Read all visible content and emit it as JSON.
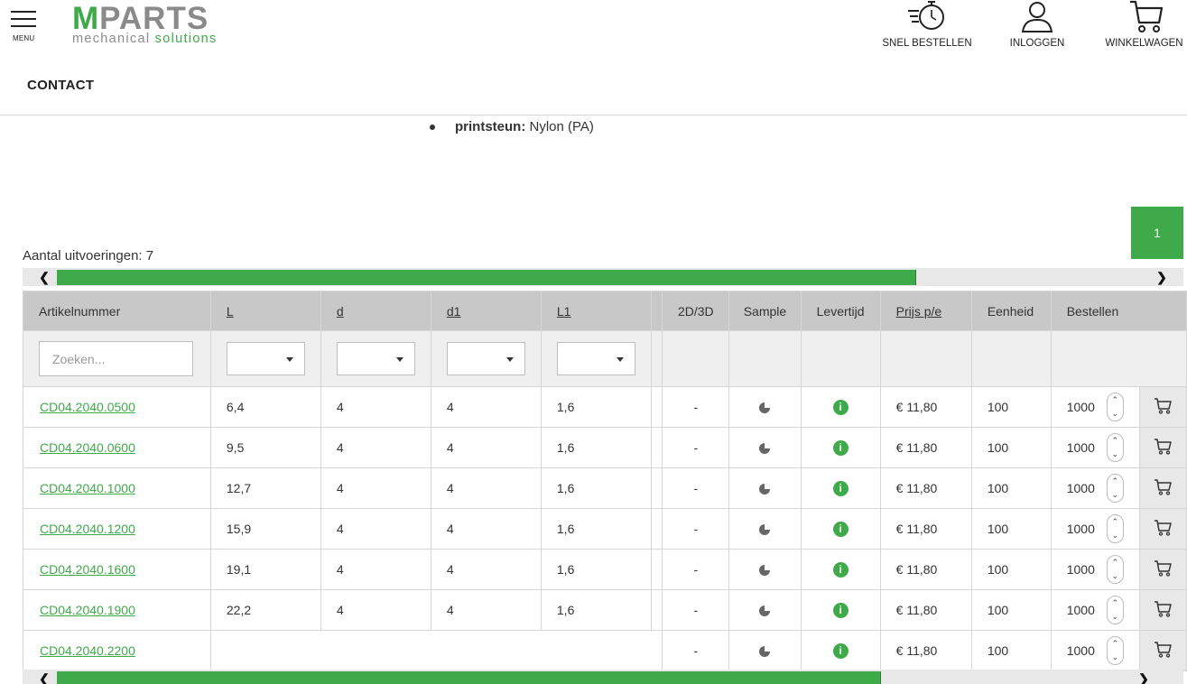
{
  "header": {
    "menu_label": "MENU",
    "logo": {
      "main_m": "M",
      "main_rest": "PARTS",
      "sub_grey": "mechanical ",
      "sub_green": "solutions"
    },
    "actions": [
      {
        "label": "SNEL BESTELLEN",
        "icon": "stopwatch-icon"
      },
      {
        "label": "INLOGGEN",
        "icon": "user-icon"
      },
      {
        "label": "WINKELWAGEN",
        "icon": "cart-icon"
      }
    ],
    "contact": "CONTACT"
  },
  "content": {
    "bullet_key": "printsteun:",
    "bullet_value": " Nylon (PA)",
    "page_number": "1",
    "variants_text": "Aantal uitvoeringen: 7"
  },
  "colors": {
    "brand_green": "#3eaa49",
    "header_grey": "#c8c8c8"
  },
  "table": {
    "headers": [
      "Artikelnummer",
      "L",
      "d",
      "d1",
      "L1",
      "2D/3D",
      "Sample",
      "Levertijd",
      "Prijs p/e",
      "Eenheid",
      "Bestellen"
    ],
    "search_placeholder": "Zoeken...",
    "rows": [
      {
        "art": "CD04.2040.0500",
        "L": "6,4",
        "d": "4",
        "d1": "4",
        "L1": "1,6",
        "cad": "-",
        "price": "€ 11,80",
        "unit": "100",
        "qty": "1000"
      },
      {
        "art": "CD04.2040.0600",
        "L": "9,5",
        "d": "4",
        "d1": "4",
        "L1": "1,6",
        "cad": "-",
        "price": "€ 11,80",
        "unit": "100",
        "qty": "1000"
      },
      {
        "art": "CD04.2040.1000",
        "L": "12,7",
        "d": "4",
        "d1": "4",
        "L1": "1,6",
        "cad": "-",
        "price": "€ 11,80",
        "unit": "100",
        "qty": "1000"
      },
      {
        "art": "CD04.2040.1200",
        "L": "15,9",
        "d": "4",
        "d1": "4",
        "L1": "1,6",
        "cad": "-",
        "price": "€ 11,80",
        "unit": "100",
        "qty": "1000"
      },
      {
        "art": "CD04.2040.1600",
        "L": "19,1",
        "d": "4",
        "d1": "4",
        "L1": "1,6",
        "cad": "-",
        "price": "€ 11,80",
        "unit": "100",
        "qty": "1000"
      },
      {
        "art": "CD04.2040.1900",
        "L": "22,2",
        "d": "4",
        "d1": "4",
        "L1": "1,6",
        "cad": "-",
        "price": "€ 11,80",
        "unit": "100",
        "qty": "1000"
      },
      {
        "art": "CD04.2040.2200",
        "L": "",
        "d": "",
        "d1": "",
        "L1": "",
        "cad": "-",
        "price": "€ 11,80",
        "unit": "100",
        "qty": "1000"
      }
    ],
    "info_glyph": "i"
  },
  "scrollbars": {
    "top_visible_fraction": 0.74,
    "bottom_visible_fraction": 0.71
  }
}
